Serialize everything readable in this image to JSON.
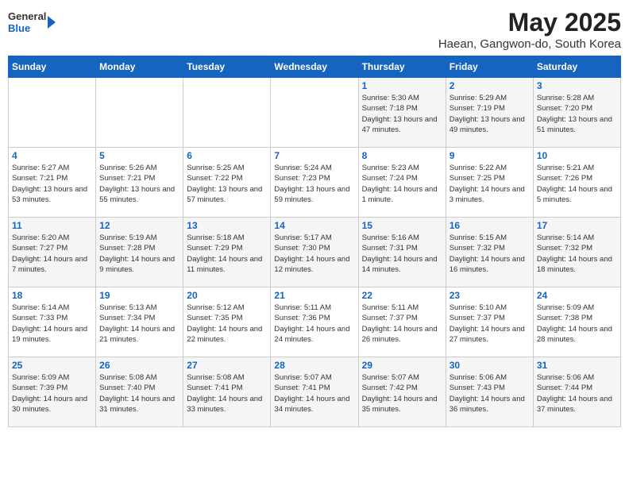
{
  "logo": {
    "general": "General",
    "blue": "Blue"
  },
  "title": "May 2025",
  "subtitle": "Haean, Gangwon-do, South Korea",
  "days_of_week": [
    "Sunday",
    "Monday",
    "Tuesday",
    "Wednesday",
    "Thursday",
    "Friday",
    "Saturday"
  ],
  "weeks": [
    [
      {
        "day": "",
        "sunrise": "",
        "sunset": "",
        "daylight": ""
      },
      {
        "day": "",
        "sunrise": "",
        "sunset": "",
        "daylight": ""
      },
      {
        "day": "",
        "sunrise": "",
        "sunset": "",
        "daylight": ""
      },
      {
        "day": "",
        "sunrise": "",
        "sunset": "",
        "daylight": ""
      },
      {
        "day": "1",
        "sunrise": "Sunrise: 5:30 AM",
        "sunset": "Sunset: 7:18 PM",
        "daylight": "Daylight: 13 hours and 47 minutes."
      },
      {
        "day": "2",
        "sunrise": "Sunrise: 5:29 AM",
        "sunset": "Sunset: 7:19 PM",
        "daylight": "Daylight: 13 hours and 49 minutes."
      },
      {
        "day": "3",
        "sunrise": "Sunrise: 5:28 AM",
        "sunset": "Sunset: 7:20 PM",
        "daylight": "Daylight: 13 hours and 51 minutes."
      }
    ],
    [
      {
        "day": "4",
        "sunrise": "Sunrise: 5:27 AM",
        "sunset": "Sunset: 7:21 PM",
        "daylight": "Daylight: 13 hours and 53 minutes."
      },
      {
        "day": "5",
        "sunrise": "Sunrise: 5:26 AM",
        "sunset": "Sunset: 7:21 PM",
        "daylight": "Daylight: 13 hours and 55 minutes."
      },
      {
        "day": "6",
        "sunrise": "Sunrise: 5:25 AM",
        "sunset": "Sunset: 7:22 PM",
        "daylight": "Daylight: 13 hours and 57 minutes."
      },
      {
        "day": "7",
        "sunrise": "Sunrise: 5:24 AM",
        "sunset": "Sunset: 7:23 PM",
        "daylight": "Daylight: 13 hours and 59 minutes."
      },
      {
        "day": "8",
        "sunrise": "Sunrise: 5:23 AM",
        "sunset": "Sunset: 7:24 PM",
        "daylight": "Daylight: 14 hours and 1 minute."
      },
      {
        "day": "9",
        "sunrise": "Sunrise: 5:22 AM",
        "sunset": "Sunset: 7:25 PM",
        "daylight": "Daylight: 14 hours and 3 minutes."
      },
      {
        "day": "10",
        "sunrise": "Sunrise: 5:21 AM",
        "sunset": "Sunset: 7:26 PM",
        "daylight": "Daylight: 14 hours and 5 minutes."
      }
    ],
    [
      {
        "day": "11",
        "sunrise": "Sunrise: 5:20 AM",
        "sunset": "Sunset: 7:27 PM",
        "daylight": "Daylight: 14 hours and 7 minutes."
      },
      {
        "day": "12",
        "sunrise": "Sunrise: 5:19 AM",
        "sunset": "Sunset: 7:28 PM",
        "daylight": "Daylight: 14 hours and 9 minutes."
      },
      {
        "day": "13",
        "sunrise": "Sunrise: 5:18 AM",
        "sunset": "Sunset: 7:29 PM",
        "daylight": "Daylight: 14 hours and 11 minutes."
      },
      {
        "day": "14",
        "sunrise": "Sunrise: 5:17 AM",
        "sunset": "Sunset: 7:30 PM",
        "daylight": "Daylight: 14 hours and 12 minutes."
      },
      {
        "day": "15",
        "sunrise": "Sunrise: 5:16 AM",
        "sunset": "Sunset: 7:31 PM",
        "daylight": "Daylight: 14 hours and 14 minutes."
      },
      {
        "day": "16",
        "sunrise": "Sunrise: 5:15 AM",
        "sunset": "Sunset: 7:32 PM",
        "daylight": "Daylight: 14 hours and 16 minutes."
      },
      {
        "day": "17",
        "sunrise": "Sunrise: 5:14 AM",
        "sunset": "Sunset: 7:32 PM",
        "daylight": "Daylight: 14 hours and 18 minutes."
      }
    ],
    [
      {
        "day": "18",
        "sunrise": "Sunrise: 5:14 AM",
        "sunset": "Sunset: 7:33 PM",
        "daylight": "Daylight: 14 hours and 19 minutes."
      },
      {
        "day": "19",
        "sunrise": "Sunrise: 5:13 AM",
        "sunset": "Sunset: 7:34 PM",
        "daylight": "Daylight: 14 hours and 21 minutes."
      },
      {
        "day": "20",
        "sunrise": "Sunrise: 5:12 AM",
        "sunset": "Sunset: 7:35 PM",
        "daylight": "Daylight: 14 hours and 22 minutes."
      },
      {
        "day": "21",
        "sunrise": "Sunrise: 5:11 AM",
        "sunset": "Sunset: 7:36 PM",
        "daylight": "Daylight: 14 hours and 24 minutes."
      },
      {
        "day": "22",
        "sunrise": "Sunrise: 5:11 AM",
        "sunset": "Sunset: 7:37 PM",
        "daylight": "Daylight: 14 hours and 26 minutes."
      },
      {
        "day": "23",
        "sunrise": "Sunrise: 5:10 AM",
        "sunset": "Sunset: 7:37 PM",
        "daylight": "Daylight: 14 hours and 27 minutes."
      },
      {
        "day": "24",
        "sunrise": "Sunrise: 5:09 AM",
        "sunset": "Sunset: 7:38 PM",
        "daylight": "Daylight: 14 hours and 28 minutes."
      }
    ],
    [
      {
        "day": "25",
        "sunrise": "Sunrise: 5:09 AM",
        "sunset": "Sunset: 7:39 PM",
        "daylight": "Daylight: 14 hours and 30 minutes."
      },
      {
        "day": "26",
        "sunrise": "Sunrise: 5:08 AM",
        "sunset": "Sunset: 7:40 PM",
        "daylight": "Daylight: 14 hours and 31 minutes."
      },
      {
        "day": "27",
        "sunrise": "Sunrise: 5:08 AM",
        "sunset": "Sunset: 7:41 PM",
        "daylight": "Daylight: 14 hours and 33 minutes."
      },
      {
        "day": "28",
        "sunrise": "Sunrise: 5:07 AM",
        "sunset": "Sunset: 7:41 PM",
        "daylight": "Daylight: 14 hours and 34 minutes."
      },
      {
        "day": "29",
        "sunrise": "Sunrise: 5:07 AM",
        "sunset": "Sunset: 7:42 PM",
        "daylight": "Daylight: 14 hours and 35 minutes."
      },
      {
        "day": "30",
        "sunrise": "Sunrise: 5:06 AM",
        "sunset": "Sunset: 7:43 PM",
        "daylight": "Daylight: 14 hours and 36 minutes."
      },
      {
        "day": "31",
        "sunrise": "Sunrise: 5:06 AM",
        "sunset": "Sunset: 7:44 PM",
        "daylight": "Daylight: 14 hours and 37 minutes."
      }
    ]
  ]
}
